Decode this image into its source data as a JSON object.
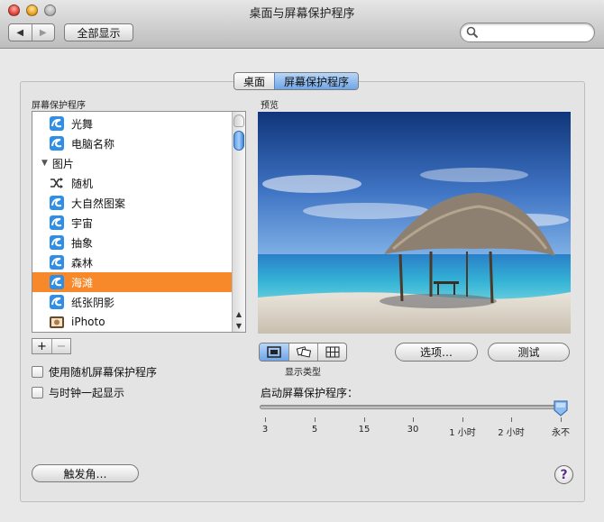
{
  "window": {
    "title": "桌面与屏幕保护程序"
  },
  "toolbar": {
    "back_label": "◀",
    "forward_label": "▶",
    "show_all_label": "全部显示",
    "search_placeholder": ""
  },
  "tabs": [
    {
      "label": "桌面"
    },
    {
      "label": "屏幕保护程序",
      "active": true
    }
  ],
  "screensaver_list": {
    "heading": "屏幕保护程序",
    "items": [
      {
        "label": "光舞",
        "icon": "screensaver-swirl-icon"
      },
      {
        "label": "电脑名称",
        "icon": "screensaver-swirl-icon"
      },
      {
        "label": "图片",
        "icon": "disclosure-triangle-icon",
        "group": true
      },
      {
        "label": "随机",
        "icon": "shuffle-icon"
      },
      {
        "label": "大自然图案",
        "icon": "screensaver-swirl-icon"
      },
      {
        "label": "宇宙",
        "icon": "screensaver-swirl-icon"
      },
      {
        "label": "抽象",
        "icon": "screensaver-swirl-icon"
      },
      {
        "label": "森林",
        "icon": "screensaver-swirl-icon"
      },
      {
        "label": "海滩",
        "icon": "screensaver-swirl-icon",
        "selected": true
      },
      {
        "label": "纸张阴影",
        "icon": "screensaver-swirl-icon"
      },
      {
        "label": "iPhoto",
        "icon": "iphoto-icon"
      }
    ],
    "add_label": "+",
    "remove_label": "−"
  },
  "options": {
    "random_label": "使用随机屏幕保护程序",
    "clock_label": "与时钟一起显示",
    "hot_corners_label": "触发角…"
  },
  "preview": {
    "heading": "预览",
    "display_type_label": "显示类型",
    "options_button": "选项…",
    "test_button": "测试"
  },
  "start_after": {
    "label": "启动屏幕保护程序：",
    "ticks": [
      "3",
      "5",
      "15",
      "30",
      "1 小时",
      "2 小时",
      "永不"
    ],
    "selected": "永不"
  },
  "help_label": "?",
  "colors": {
    "selection": "#f7892a",
    "accent_blue": "#6fa5e6"
  }
}
